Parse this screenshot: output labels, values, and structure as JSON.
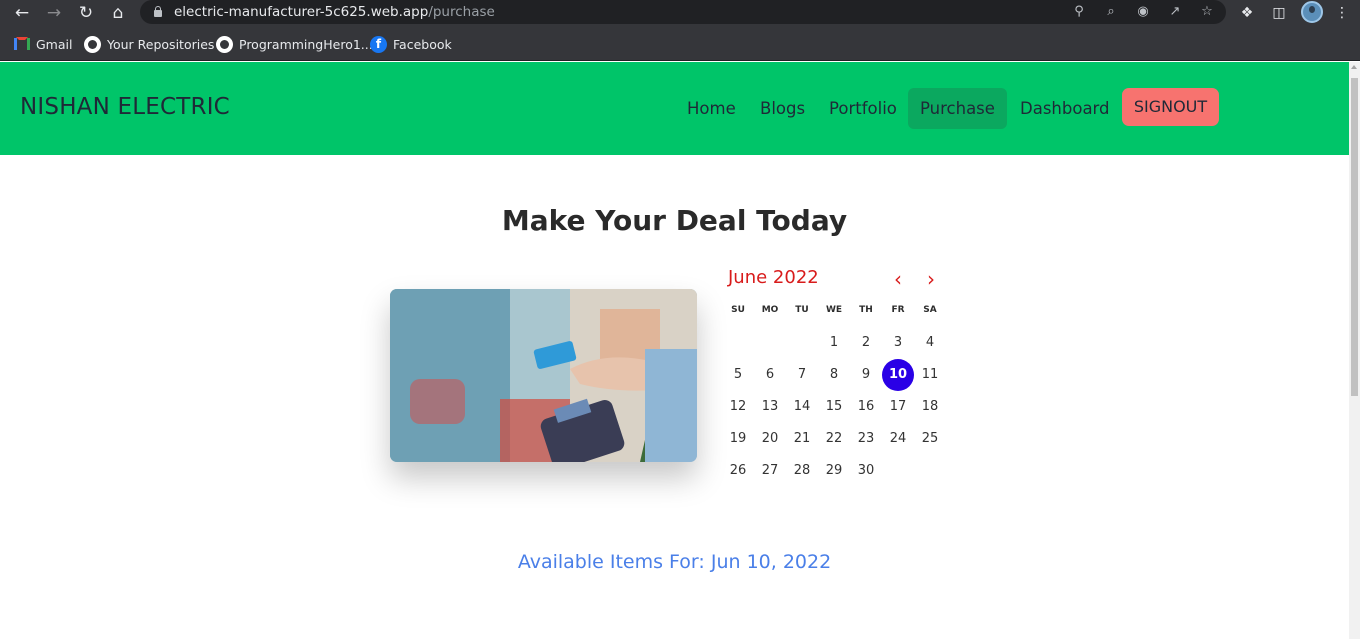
{
  "browser": {
    "url_host": "electric-manufacturer-5c625.web.app",
    "url_path": "/purchase",
    "nav_icons": [
      "back-arrow-icon",
      "forward-arrow-icon",
      "reload-icon",
      "home-icon"
    ],
    "omnibox_icons": [
      "key-icon",
      "zoom-icon",
      "eye-off-icon",
      "share-icon",
      "star-icon"
    ],
    "toolbar_icons": [
      "puzzle-icon",
      "sidebar-icon",
      "avatar",
      "kebab-menu-icon"
    ],
    "bookmarks": [
      {
        "label": "Gmail",
        "icon": "gmail-icon"
      },
      {
        "label": "Your Repositories",
        "icon": "github-icon"
      },
      {
        "label": "ProgrammingHero1...",
        "icon": "github-icon"
      },
      {
        "label": "Facebook",
        "icon": "facebook-icon"
      }
    ]
  },
  "site": {
    "brand": "NISHAN ELECTRIC",
    "nav": [
      "Home",
      "Blogs",
      "Portfolio",
      "Purchase",
      "Dashboard"
    ],
    "active_nav": "Purchase",
    "signout": "SIGNOUT",
    "colors": {
      "header": "#00c569",
      "signout": "#f7736f",
      "accent_red": "#d81b1b",
      "selected_day": "#2a00e6",
      "available_text": "#4a7fe8"
    }
  },
  "main": {
    "title": "Make Your Deal Today",
    "image": "payment-card-image",
    "calendar": {
      "month": "June 2022",
      "weekdays": [
        "SU",
        "MO",
        "TU",
        "WE",
        "TH",
        "FR",
        "SA"
      ],
      "days": [
        "1",
        "2",
        "3",
        "4",
        "5",
        "6",
        "7",
        "8",
        "9",
        "10",
        "11",
        "12",
        "13",
        "14",
        "15",
        "16",
        "17",
        "18",
        "19",
        "20",
        "21",
        "22",
        "23",
        "24",
        "25",
        "26",
        "27",
        "28",
        "29",
        "30"
      ],
      "selected": "10"
    },
    "available": "Available Items For: Jun 10, 2022"
  }
}
